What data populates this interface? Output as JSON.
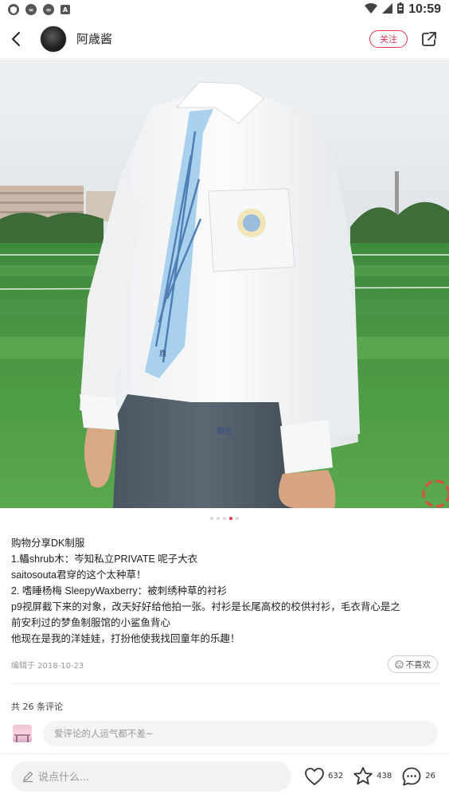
{
  "status_bar": {
    "time": "10:59",
    "left_icons": [
      "shield-icon",
      "infinity-icon",
      "infinity-icon",
      "letter-a-icon"
    ],
    "right_icons": [
      "wifi-icon",
      "signal-icon",
      "battery-icon"
    ]
  },
  "header": {
    "username": "阿歳酱",
    "follow_label": "关注",
    "accent_color": "#e8344e"
  },
  "carousel": {
    "total": 5,
    "active_index": 3
  },
  "post": {
    "lines": [
      "购物分享DK制服",
      "1.轠shrub木：岑知私立PRIVATE 呢子大衣",
      "saitosouta君穿的这个太种草！",
      "2. 嗜睡杨梅 SleepyWaxberry：被刺绣种草的衬衫",
      "p9视屏截下来的对象，改天好好给他拍一张。衬衫是长尾高校的校供衬衫，毛衣背心是之",
      "前安利过的梦鱼制服馆的小鲨鱼背心",
      "他现在是我的洋娃娃，打扮他使我找回童年的乐趣！"
    ],
    "edit_date": "编辑于 2018-10-23",
    "dislike_label": "不喜欢"
  },
  "comments": {
    "count_label": "共 26 条评论",
    "placeholder": "爱评论的人运气都不差~"
  },
  "bottom_bar": {
    "say_placeholder": "说点什么...",
    "likes": "632",
    "favorites": "438",
    "comments": "26"
  }
}
